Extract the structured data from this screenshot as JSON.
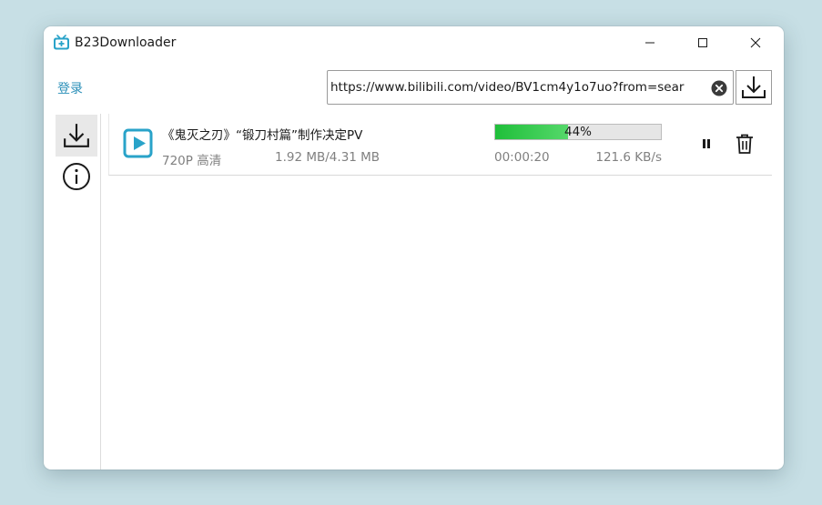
{
  "window": {
    "title": "B23Downloader",
    "app_icon": "bilibili-tv-icon",
    "controls": [
      "minimize-icon",
      "maximize-icon",
      "close-icon"
    ]
  },
  "header": {
    "login_label": "登录",
    "url_value": "https://www.bilibili.com/video/BV1cm4y1o7uo?from=sear",
    "clear_icon": "clear-circle-icon",
    "download_icon": "download-icon"
  },
  "sidebar": {
    "items": [
      {
        "name": "downloads",
        "icon": "download-icon",
        "selected": true
      },
      {
        "name": "about",
        "icon": "info-icon",
        "selected": false
      }
    ]
  },
  "downloads": [
    {
      "icon": "video-play-icon",
      "title": "《鬼灭之刃》“锻刀村篇”制作决定PV",
      "quality": "720P 高清",
      "size": "1.92 MB/4.31 MB",
      "progress_text": "44%",
      "progress": 0.44,
      "elapsed": "00:00:20",
      "speed": "121.6 KB/s"
    }
  ],
  "colors": {
    "accent": "#2a8fb8",
    "progress": "#2ec748",
    "icon_blue": "#29a3c9",
    "background": "#c7dfe5"
  }
}
